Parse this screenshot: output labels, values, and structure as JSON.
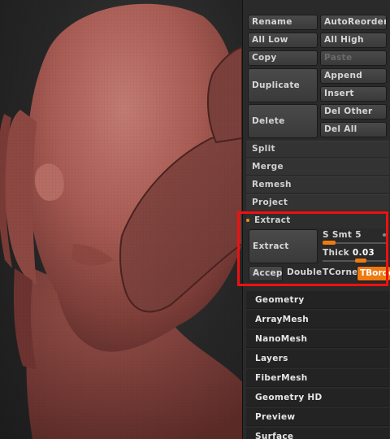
{
  "subtool": {
    "rename": "Rename",
    "autoreorder": "AutoReorder",
    "all_low": "All Low",
    "all_high": "All High",
    "copy": "Copy",
    "paste": "Paste",
    "duplicate": "Duplicate",
    "append": "Append",
    "insert": "Insert",
    "delete": "Delete",
    "del_other": "Del Other",
    "del_all": "Del All"
  },
  "sections": {
    "split": "Split",
    "merge": "Merge",
    "remesh": "Remesh",
    "project": "Project"
  },
  "extract": {
    "title": "Extract",
    "button": "Extract",
    "s_smt_label": "S Smt",
    "s_smt_value": "5",
    "s_smt_fill": 0.2,
    "thick_label": "Thick",
    "thick_value": "0.03",
    "thick_fill": 0.6,
    "accept": "Accept",
    "double": "Double",
    "tcorner": "TCorne",
    "tborder": "TBorde"
  },
  "menus": [
    "Geometry",
    "ArrayMesh",
    "NanoMesh",
    "Layers",
    "FiberMesh",
    "Geometry HD",
    "Preview",
    "Surface"
  ],
  "colors": {
    "accent": "#f07a10",
    "highlight_box": "#ee1111",
    "clay": "#a65a52"
  }
}
